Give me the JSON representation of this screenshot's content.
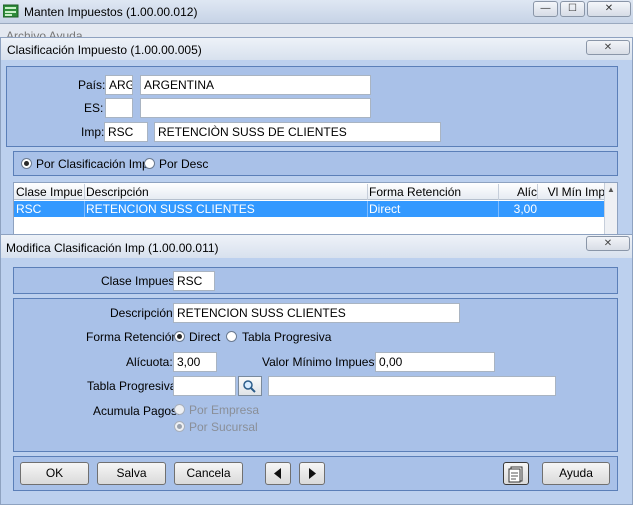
{
  "main_window": {
    "title": "Manten Impuestos (1.00.00.012)",
    "menu_partial": "Archivo   Ayuda"
  },
  "clasificacion": {
    "title": "Clasificación Impuesto (1.00.00.005)",
    "pais_label": "País:",
    "pais_code": "ARG",
    "pais_name": "ARGENTINA",
    "es_label": "ES:",
    "es_code": "",
    "es_name": "",
    "imp_label": "Imp:",
    "imp_code": "RSC",
    "imp_name": "RETENCIÒN SUSS DE CLIENTES",
    "radio_clasif": "Por Clasificación Imp",
    "radio_desc": "Por Desc",
    "grid": {
      "columns": [
        "Clase Impuest",
        "Descripción",
        "Forma Retención",
        "Alíc",
        "Vl Mín Imp"
      ],
      "rows": [
        [
          "RSC",
          "RETENCION SUSS CLIENTES",
          "Direct",
          "3,00",
          ""
        ]
      ]
    }
  },
  "modifica": {
    "title": "Modifica Clasificación Imp (1.00.00.011)",
    "clase_label": "Clase Impuest:",
    "clase_value": "RSC",
    "desc_label": "Descripción:",
    "desc_value": "RETENCION SUSS CLIENTES",
    "forma_label": "Forma Retención:",
    "forma_direct": "Direct",
    "forma_tabla": "Tabla Progresiva",
    "alicuota_label": "Alícuota:",
    "alicuota_value": "3,00",
    "vmin_label": "Valor Mínimo Impuesto:",
    "vmin_value": "0,00",
    "tabla_label": "Tabla Progresiva:",
    "tabla_code": "",
    "tabla_desc": "",
    "acumula_label": "Acumula Pagos:",
    "acumula_empresa": "Por Empresa",
    "acumula_sucursal": "Por Sucursal",
    "buttons": {
      "ok": "OK",
      "salva": "Salva",
      "cancela": "Cancela",
      "ayuda": "Ayuda"
    }
  }
}
